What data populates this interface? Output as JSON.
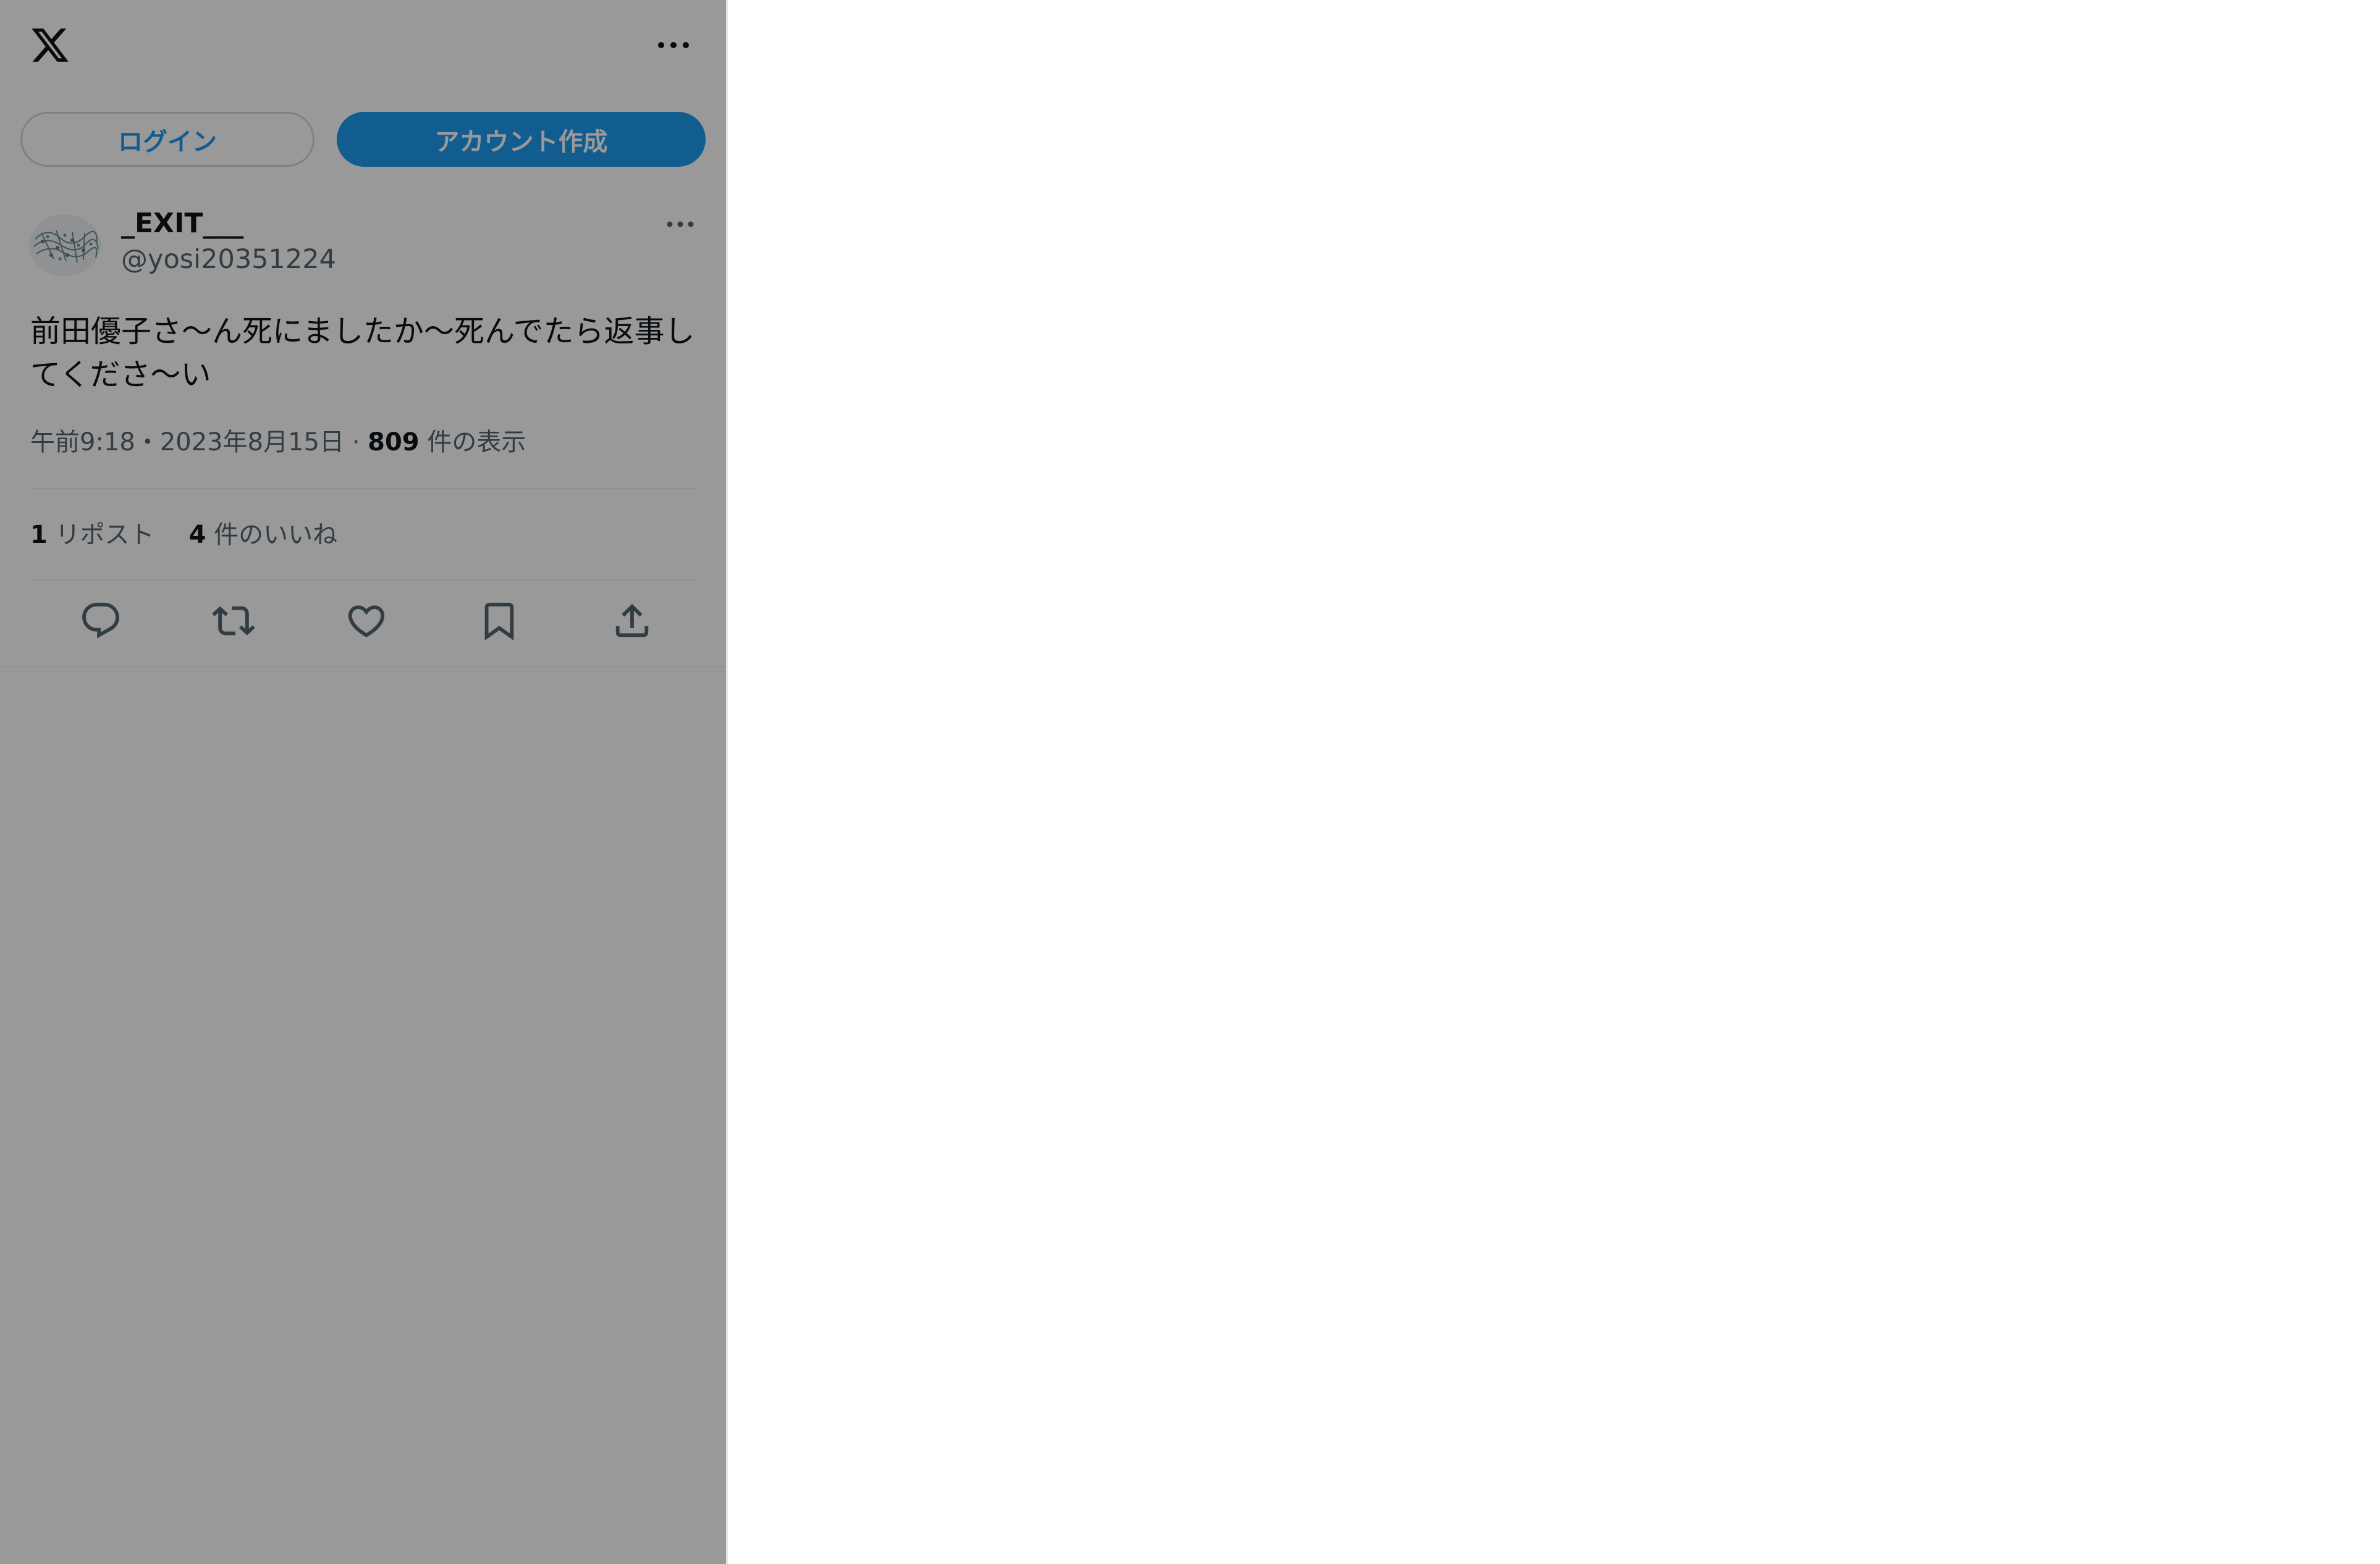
{
  "header": {
    "logo_icon": "x-logo-icon",
    "more_icon": "more-horizontal-icon"
  },
  "auth": {
    "login_label": "ログイン",
    "signup_label": "アカウント作成"
  },
  "tweet": {
    "display_name": "_EXIT___",
    "handle": "@yosi20351224",
    "text": "前田優子さ〜ん死にましたか〜死んでたら返事してくださ〜い",
    "time": "午前9:18",
    "date": "2023年8月15日",
    "separator": "・",
    "views_count": "809",
    "views_label": "件の表示",
    "reposts_count": "1",
    "reposts_label": "リポスト",
    "likes_count": "4",
    "likes_label": "件のいいね"
  },
  "actions": {
    "reply_icon": "reply-icon",
    "repost_icon": "repost-icon",
    "like_icon": "heart-icon",
    "bookmark_icon": "bookmark-icon",
    "share_icon": "share-icon"
  },
  "colors": {
    "accent": "#1d9bf0",
    "text_primary": "#0f1419",
    "text_secondary": "#536471",
    "overlay": "rgba(0,0,0,0.4)"
  }
}
